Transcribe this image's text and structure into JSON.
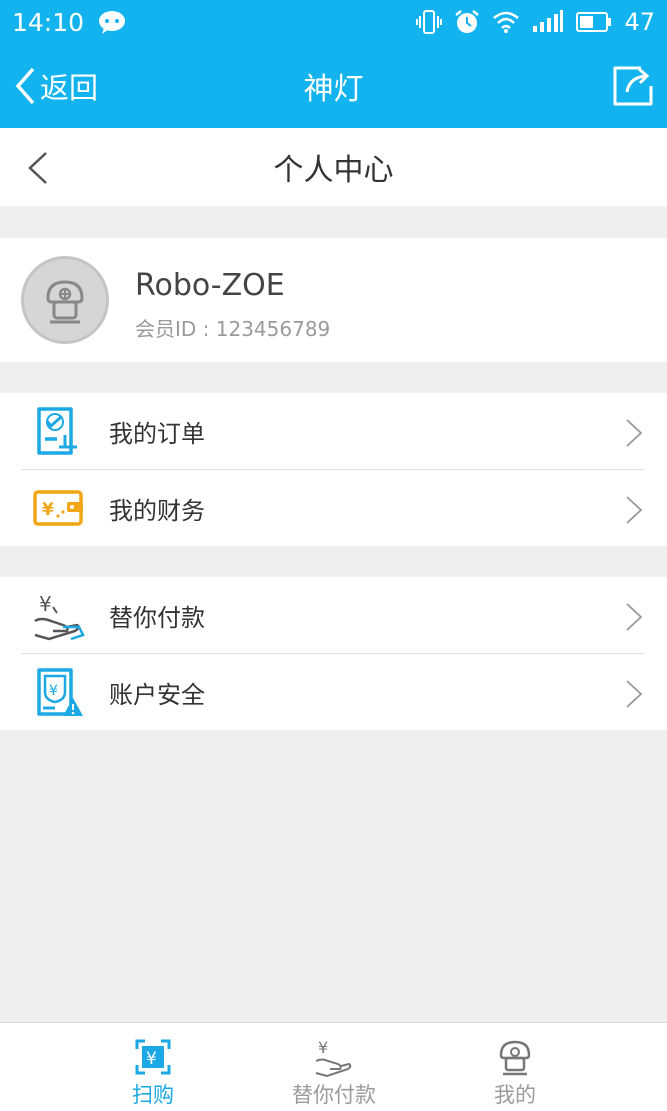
{
  "status_bar": {
    "time": "14:10",
    "battery": "47"
  },
  "nav": {
    "back_label": "返回",
    "title": "神灯"
  },
  "subheader": {
    "title": "个人中心"
  },
  "profile": {
    "username": "Robo-ZOE",
    "member_id": "会员ID : 123456789"
  },
  "menu_groups": [
    {
      "items": [
        {
          "label": "我的订单",
          "icon": "order-icon"
        },
        {
          "label": "我的财务",
          "icon": "wallet-icon"
        }
      ]
    },
    {
      "items": [
        {
          "label": "替你付款",
          "icon": "pay-for-you-icon"
        },
        {
          "label": "账户安全",
          "icon": "account-security-icon"
        }
      ]
    }
  ],
  "tabbar": {
    "tabs": [
      {
        "label": "扫购",
        "icon": "scan-buy-icon",
        "active": true
      },
      {
        "label": "替你付款",
        "icon": "pay-for-you-icon",
        "active": false
      },
      {
        "label": "我的",
        "icon": "profile-icon",
        "active": false
      }
    ]
  },
  "colors": {
    "accent": "#12b3ee",
    "active_tab": "#1ba8e4",
    "wallet": "#f2a516",
    "background": "#efefef"
  }
}
